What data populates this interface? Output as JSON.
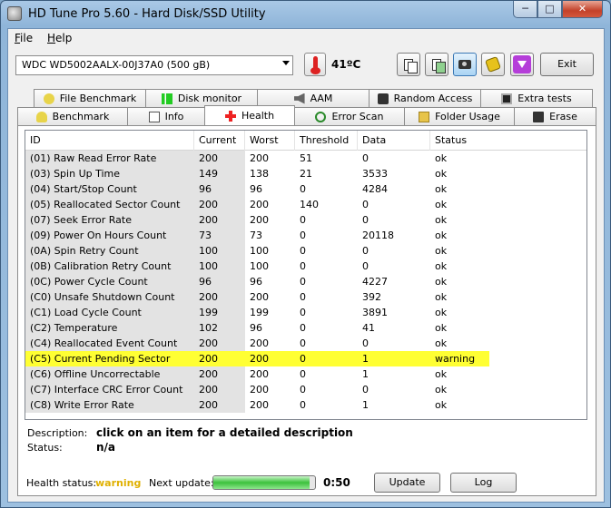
{
  "window": {
    "title": "HD Tune Pro 5.60 - Hard Disk/SSD Utility"
  },
  "caption": {
    "minimize": "─",
    "maximize": "□",
    "close": "✕"
  },
  "menu": {
    "file": {
      "first": "F",
      "rest": "ile"
    },
    "help": {
      "first": "H",
      "rest": "elp"
    }
  },
  "toolbar": {
    "drive": "WDC WD5002AALX-00J37A0 (500 gB)",
    "temperature": "41ºC",
    "exit_label": "Exit"
  },
  "tabs_top": [
    "File Benchmark",
    "Disk monitor",
    "AAM",
    "Random Access",
    "Extra tests"
  ],
  "tabs_bottom": [
    "Benchmark",
    "Info",
    "Health",
    "Error Scan",
    "Folder Usage",
    "Erase"
  ],
  "selected_tab": "Health",
  "columns": [
    "ID",
    "Current",
    "Worst",
    "Threshold",
    "Data",
    "Status"
  ],
  "rows": [
    [
      "(01) Raw Read Error Rate",
      "200",
      "200",
      "51",
      "0",
      "ok"
    ],
    [
      "(03) Spin Up Time",
      "149",
      "138",
      "21",
      "3533",
      "ok"
    ],
    [
      "(04) Start/Stop Count",
      "96",
      "96",
      "0",
      "4284",
      "ok"
    ],
    [
      "(05) Reallocated Sector Count",
      "200",
      "200",
      "140",
      "0",
      "ok"
    ],
    [
      "(07) Seek Error Rate",
      "200",
      "200",
      "0",
      "0",
      "ok"
    ],
    [
      "(09) Power On Hours Count",
      "73",
      "73",
      "0",
      "20118",
      "ok"
    ],
    [
      "(0A) Spin Retry Count",
      "100",
      "100",
      "0",
      "0",
      "ok"
    ],
    [
      "(0B) Calibration Retry Count",
      "100",
      "100",
      "0",
      "0",
      "ok"
    ],
    [
      "(0C) Power Cycle Count",
      "96",
      "96",
      "0",
      "4227",
      "ok"
    ],
    [
      "(C0) Unsafe Shutdown Count",
      "200",
      "200",
      "0",
      "392",
      "ok"
    ],
    [
      "(C1) Load Cycle Count",
      "199",
      "199",
      "0",
      "3891",
      "ok"
    ],
    [
      "(C2) Temperature",
      "102",
      "96",
      "0",
      "41",
      "ok"
    ],
    [
      "(C4) Reallocated Event Count",
      "200",
      "200",
      "0",
      "0",
      "ok"
    ],
    [
      "(C5) Current Pending Sector",
      "200",
      "200",
      "0",
      "1",
      "warning"
    ],
    [
      "(C6) Offline Uncorrectable",
      "200",
      "200",
      "0",
      "1",
      "ok"
    ],
    [
      "(C7) Interface CRC Error Count",
      "200",
      "200",
      "0",
      "0",
      "ok"
    ],
    [
      "(C8) Write Error Rate",
      "200",
      "200",
      "0",
      "1",
      "ok"
    ]
  ],
  "highlight_color": "#ffff33",
  "description": {
    "label": "Description:",
    "value": "click on an item for a detailed description",
    "status_label": "Status:",
    "status_value": "n/a"
  },
  "footer": {
    "health_label": "Health status:",
    "health_value": "warning",
    "health_color": "#e0b000",
    "next_update_label": "Next update:",
    "progress_fraction": 0.95,
    "countdown": "0:50",
    "update_label": "Update",
    "log_label": "Log"
  }
}
